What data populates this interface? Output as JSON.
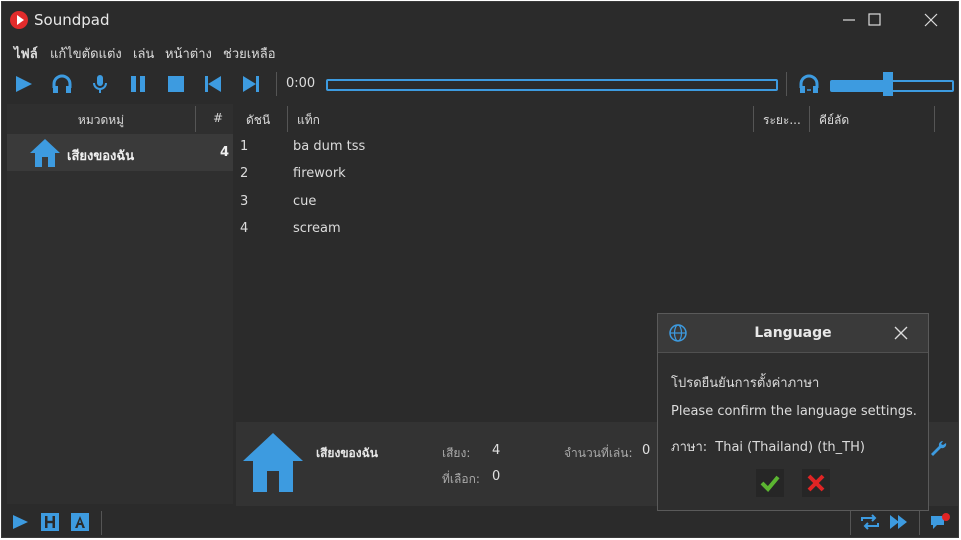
{
  "window": {
    "title": "Soundpad"
  },
  "menu": [
    "ไฟล์",
    "แก้ไขตัดแต่ง",
    "เล่น",
    "หน้าต่าง",
    "ช่วยเหลือ"
  ],
  "player": {
    "time": "0:00",
    "volume_fraction": 0.5
  },
  "categories": {
    "header_category": "หมวดหมู่",
    "header_count": "#",
    "items": [
      {
        "name": "เสียงของฉัน",
        "count": "4"
      }
    ]
  },
  "sound_list": {
    "headers": {
      "index": "ดัชนี",
      "track": "แท็ก",
      "duration": "ระยะ...",
      "hotkey": "คีย์ลัด"
    },
    "rows": [
      {
        "index": "1",
        "name": "ba dum tss"
      },
      {
        "index": "2",
        "name": "firework"
      },
      {
        "index": "3",
        "name": "cue"
      },
      {
        "index": "4",
        "name": "scream"
      }
    ]
  },
  "info": {
    "name": "เสียงของฉัน",
    "sounds_label": "เสียง:",
    "sounds_value": "4",
    "selected_label": "ที่เลือก:",
    "selected_value": "0",
    "plays_label": "จำนวนที่เล่น:",
    "plays_value": "0"
  },
  "dialog": {
    "title": "Language",
    "line_thai": "โปรดยืนยันการตั้งค่าภาษา",
    "line_english": "Please confirm the language settings.",
    "language_label": "ภาษา:",
    "language_value": "Thai (Thailand) (th_TH)"
  },
  "colors": {
    "accent": "#3d9be0",
    "confirm": "#5bb531",
    "cancel": "#e02424",
    "brand": "#e22b2b"
  }
}
